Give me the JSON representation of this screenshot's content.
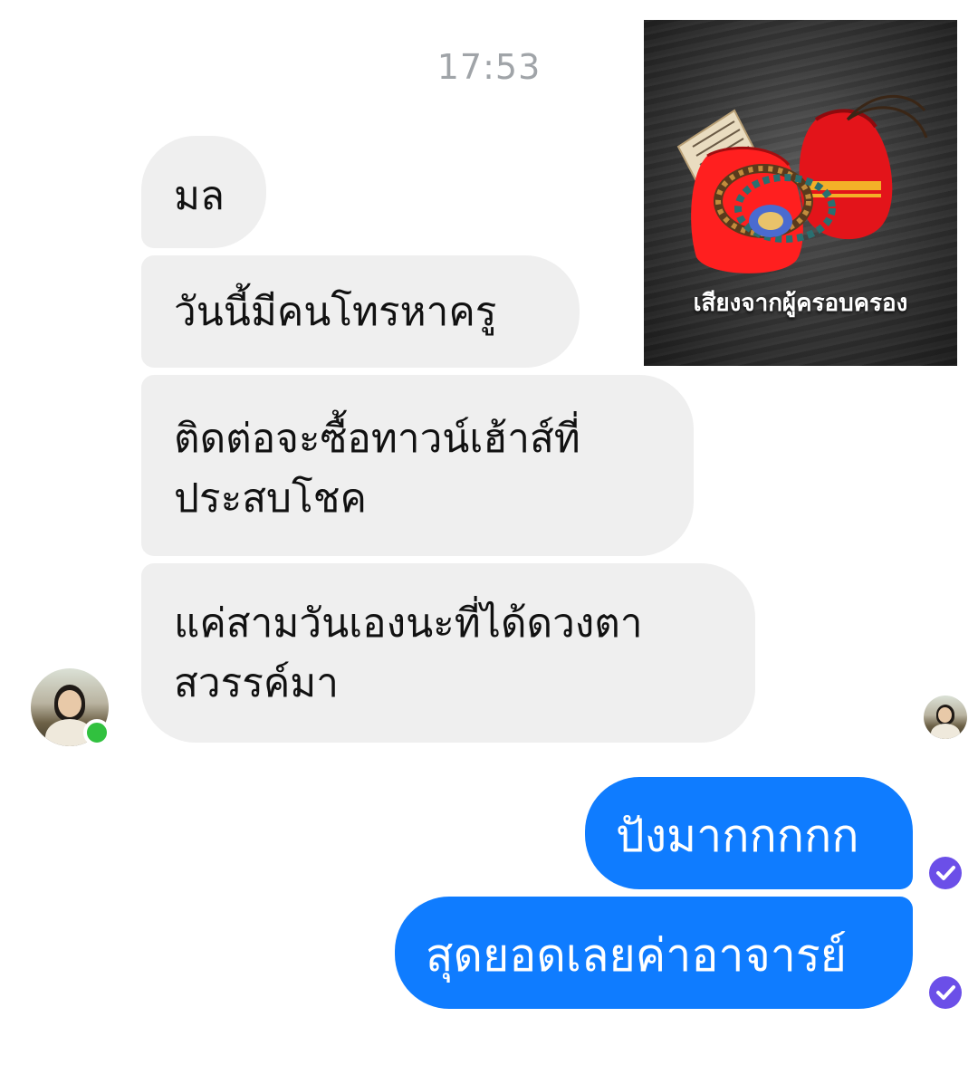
{
  "conversation": {
    "timestamp": "17:53",
    "incoming": [
      {
        "line1": "มล",
        "line2": ""
      },
      {
        "line1": "วันนี้มีคนโทรหาครู",
        "line2": ""
      },
      {
        "line1": "ติดต่อจะซื้อทาวน์เฮ้าส์ที่",
        "line2": "ประสบโชค"
      },
      {
        "line1": "แค่สามวันเองนะที่ได้ดวงตา",
        "line2": "สวรรค์มา"
      }
    ],
    "outgoing": [
      {
        "text": "ปังมากกกกก"
      },
      {
        "text": "สุดยอดเลยค่าอาจารย์"
      }
    ],
    "image_message": {
      "caption": "เสียงจากผู้ครอบครอง",
      "icon": "product-photo"
    }
  },
  "colors": {
    "outgoing_bubble": "#0f7cff",
    "incoming_bubble": "#efefef",
    "online_status": "#31c13f",
    "seen_check": "#6b4fe8"
  },
  "icons": {
    "seen": "check-circle-icon",
    "online": "online-dot-icon"
  }
}
